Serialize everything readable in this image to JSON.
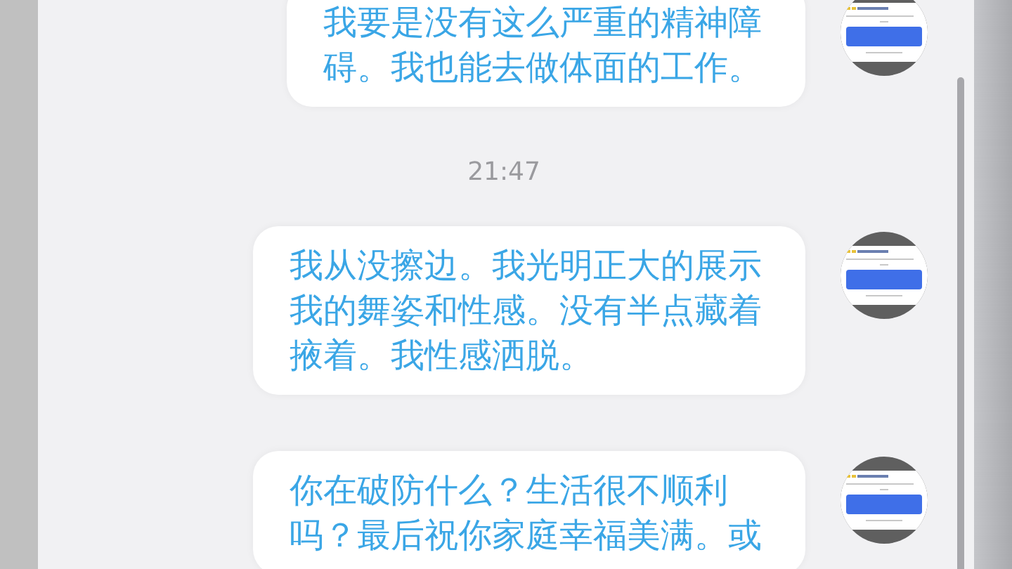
{
  "messages": [
    {
      "kind": "text",
      "text": "我要是没有这么严重的精神障碍。我也能去做体面的工作。"
    },
    {
      "kind": "time",
      "text": "21:47"
    },
    {
      "kind": "text",
      "text": "我从没擦边。我光明正大的展示我的舞姿和性感。没有半点藏着掖着。我性感洒脱。"
    },
    {
      "kind": "text",
      "text": "你在破防什么？生活很不顺利吗？最后祝你家庭幸福美满。或"
    }
  ]
}
